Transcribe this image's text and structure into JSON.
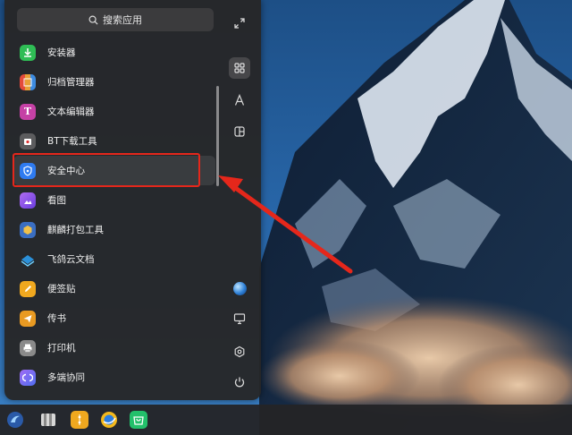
{
  "search": {
    "label": "搜索应用"
  },
  "apps": [
    {
      "label": "安装器",
      "icon": "installer-icon",
      "color": "#2fbd55"
    },
    {
      "label": "归档管理器",
      "icon": "archive-manager-icon",
      "color": "#e9a036"
    },
    {
      "label": "文本编辑器",
      "icon": "text-editor-icon",
      "color": "#c541a5"
    },
    {
      "label": "BT下载工具",
      "icon": "bt-download-icon",
      "color": "#6b6b6b"
    },
    {
      "label": "安全中心",
      "icon": "security-center-icon",
      "color": "#2f7bf0"
    },
    {
      "label": "看图",
      "icon": "image-viewer-icon",
      "color": "#8a4fe6"
    },
    {
      "label": "麒麟打包工具",
      "icon": "kylin-packaging-icon",
      "color": "#3a6ec2"
    },
    {
      "label": "飞鸽云文档",
      "icon": "cloud-docs-icon",
      "color": "#2b90d9"
    },
    {
      "label": "便签贴",
      "icon": "sticky-notes-icon",
      "color": "#f0a81f"
    },
    {
      "label": "传书",
      "icon": "file-transfer-icon",
      "color": "#e99a22"
    },
    {
      "label": "打印机",
      "icon": "printer-icon",
      "color": "#8a8a8a"
    },
    {
      "label": "多端协同",
      "icon": "multi-device-icon",
      "color": "#7c5af0"
    }
  ],
  "selected_index": 4,
  "rail": {
    "expand": "expand-icon",
    "category": "grid-view-icon",
    "alphabetical": "letter-a-icon",
    "function": "function-sort-icon",
    "user": "user-avatar-icon",
    "computer": "computer-icon",
    "settings": "gear-icon",
    "power": "power-icon"
  },
  "taskbar": [
    {
      "icon": "kylin-start-icon"
    },
    {
      "icon": "file-manager-icon"
    },
    {
      "icon": "settings-app-icon"
    },
    {
      "icon": "browser-icon"
    },
    {
      "icon": "app-store-icon"
    }
  ],
  "annotation_color": "#e5271b"
}
